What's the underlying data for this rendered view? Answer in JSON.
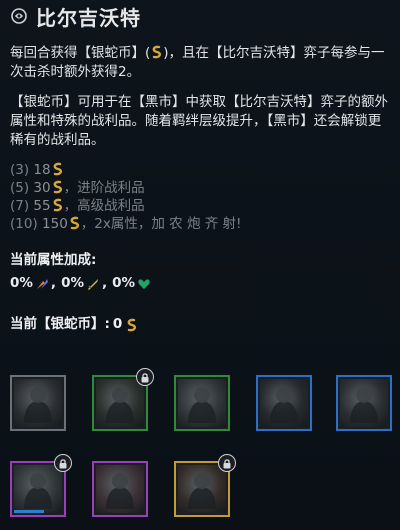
{
  "trait": {
    "name": "比尔吉沃特",
    "icon": "trait-emblem-icon"
  },
  "description": {
    "line1_part1": "每回合获得【银蛇币】(",
    "line1_part2": ")，且在【比尔吉沃特】弈子每参与一次击杀时额外获得2。",
    "line2": "【银蛇币】可用于在【黑市】中获取【比尔吉沃特】弈子的额外属性和特殊的战利品。随着羁绊层级提升，【黑市】还会解锁更稀有的战利品。"
  },
  "tiers": [
    {
      "count": "(3)",
      "value": "18",
      "text": ""
    },
    {
      "count": "(5)",
      "value": "30",
      "text": "，进阶战利品"
    },
    {
      "count": "(7)",
      "value": "55",
      "text": "，高级战利品"
    },
    {
      "count": "(10)",
      "value": "150",
      "text": "，2x属性，加 农 炮 齐 射!"
    }
  ],
  "bonus": {
    "label": "当前属性加成:",
    "stats": [
      {
        "value": "0%",
        "icon": "attack-damage-ability-power-icon",
        "sep": ","
      },
      {
        "value": "0%",
        "icon": "sword-icon",
        "sep": ","
      },
      {
        "value": "0%",
        "icon": "health-heart-icon",
        "sep": ""
      }
    ]
  },
  "current": {
    "label": "当前【银蛇币】:",
    "value": "0"
  },
  "champions": [
    {
      "name": "champion-slot-1",
      "border": "#6b7178",
      "bg": "#2b2e31",
      "locked": false
    },
    {
      "name": "champion-slot-2",
      "border": "#2f8a3a",
      "bg": "#2a2f2c",
      "locked": true
    },
    {
      "name": "champion-slot-3",
      "border": "#2f8a3a",
      "bg": "#303437",
      "locked": false
    },
    {
      "name": "champion-slot-4",
      "border": "#2d6fc2",
      "bg": "#25282c",
      "locked": false
    },
    {
      "name": "champion-slot-5",
      "border": "#2d6fc2",
      "bg": "#2a2d31",
      "locked": false
    },
    {
      "name": "champion-slot-6",
      "border": "#9a3fb8",
      "bg": "#2f3438",
      "locked": true
    },
    {
      "name": "champion-slot-7",
      "border": "#9a3fb8",
      "bg": "#3a3033",
      "locked": false
    },
    {
      "name": "champion-slot-8",
      "border": "#c59a3c",
      "bg": "#332c28",
      "locked": true
    }
  ],
  "colors": {
    "coin": "#d8a53a",
    "muted_text": "#7b8188",
    "heart": "#1fa36a"
  }
}
